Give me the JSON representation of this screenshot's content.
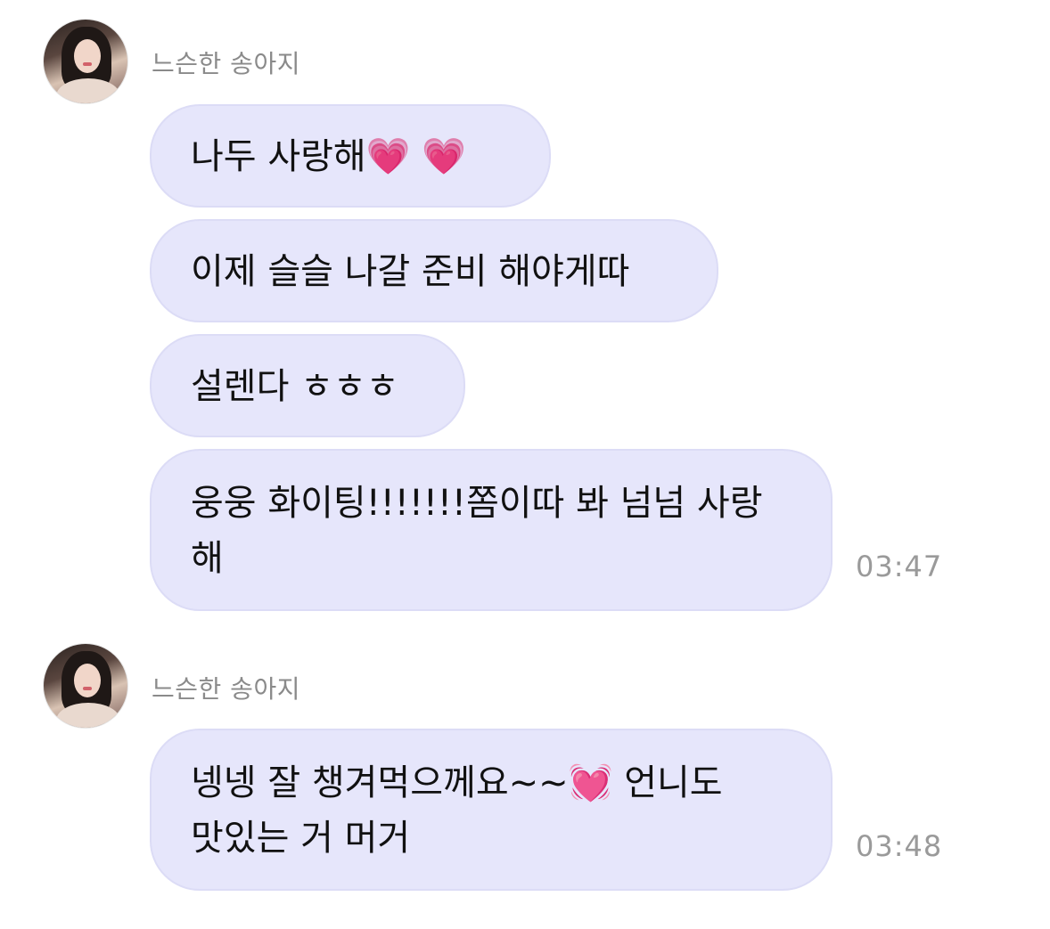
{
  "groups": [
    {
      "sender": "느슨한 송아지",
      "avatar_icon": "profile-photo",
      "messages": [
        {
          "text": "나두 사랑해",
          "emoji": "💗 💗"
        },
        {
          "text": "이제 슬슬 나갈 준비 해야게따"
        },
        {
          "text": "설렌다 ㅎㅎㅎ"
        },
        {
          "line1": "웅웅 화이팅!!!!!!!쫌이따 봐 넘넘 사랑",
          "line2": "해"
        }
      ],
      "time": "03:47"
    },
    {
      "sender": "느슨한 송아지",
      "avatar_icon": "profile-photo",
      "messages": [
        {
          "line1_text": "넹넹 잘 챙겨먹으께요~~",
          "line1_emoji": "💓",
          "line1_tail": " 언니도",
          "line2": "맛있는 거 머거"
        }
      ],
      "time": "03:48"
    }
  ],
  "colors": {
    "bubble": "#e6e6fb",
    "sender_text": "#8a8a8a",
    "time_text": "#9a9a9a"
  }
}
